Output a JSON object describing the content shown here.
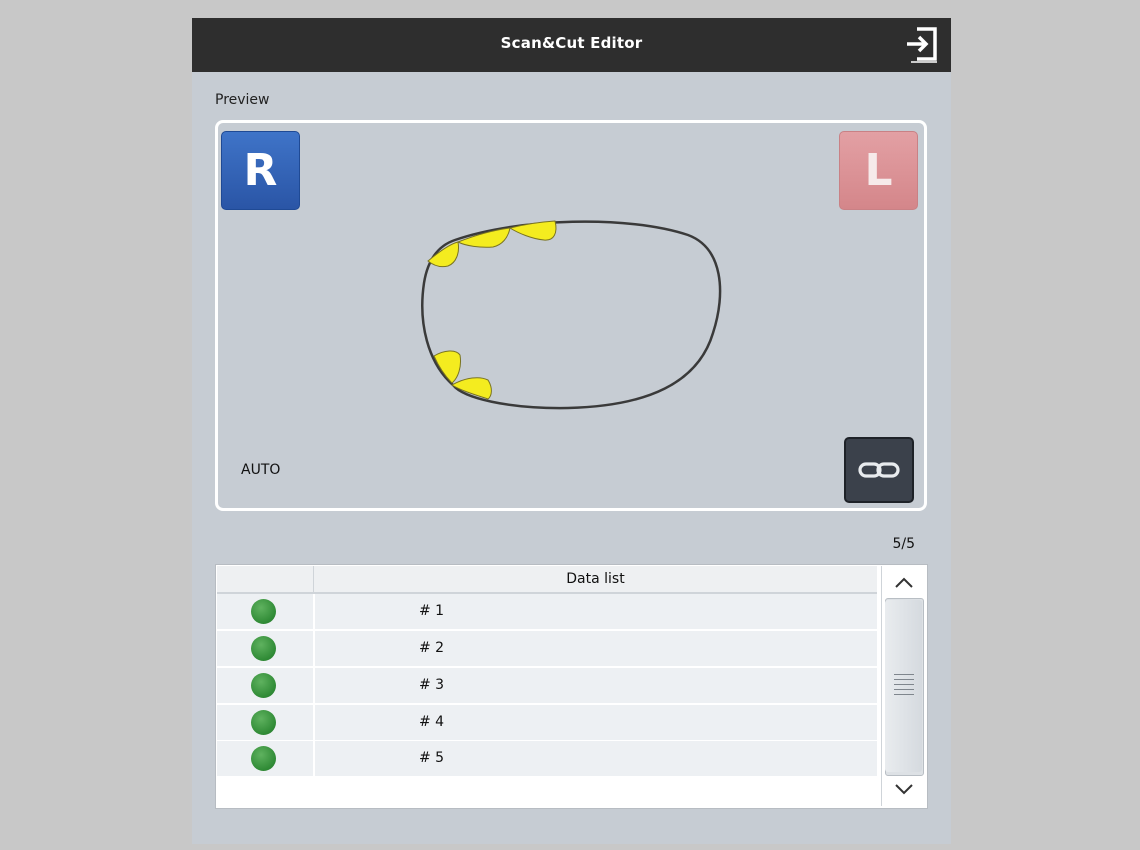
{
  "window": {
    "title": "Scan&Cut Editor",
    "exit_icon": "exit-icon"
  },
  "preview": {
    "label": "Preview",
    "right_eye_label": "R",
    "left_eye_label": "L",
    "mode": "AUTO",
    "link_icon": "link-icon",
    "colors": {
      "right_eye": "#2f5fb3",
      "left_eye": "#dc9296",
      "cut_marks": "#f4ec1f",
      "lens_outline": "#3a3a3a"
    }
  },
  "list": {
    "counter": "5/5",
    "header": "Data list",
    "rows": [
      {
        "label": "#  1",
        "status": "green"
      },
      {
        "label": "#  2",
        "status": "green"
      },
      {
        "label": "#  3",
        "status": "green"
      },
      {
        "label": "#  4",
        "status": "green"
      },
      {
        "label": "#  5",
        "status": "green"
      }
    ],
    "scroll_up_icon": "chevron-up-icon",
    "scroll_down_icon": "chevron-down-icon"
  }
}
